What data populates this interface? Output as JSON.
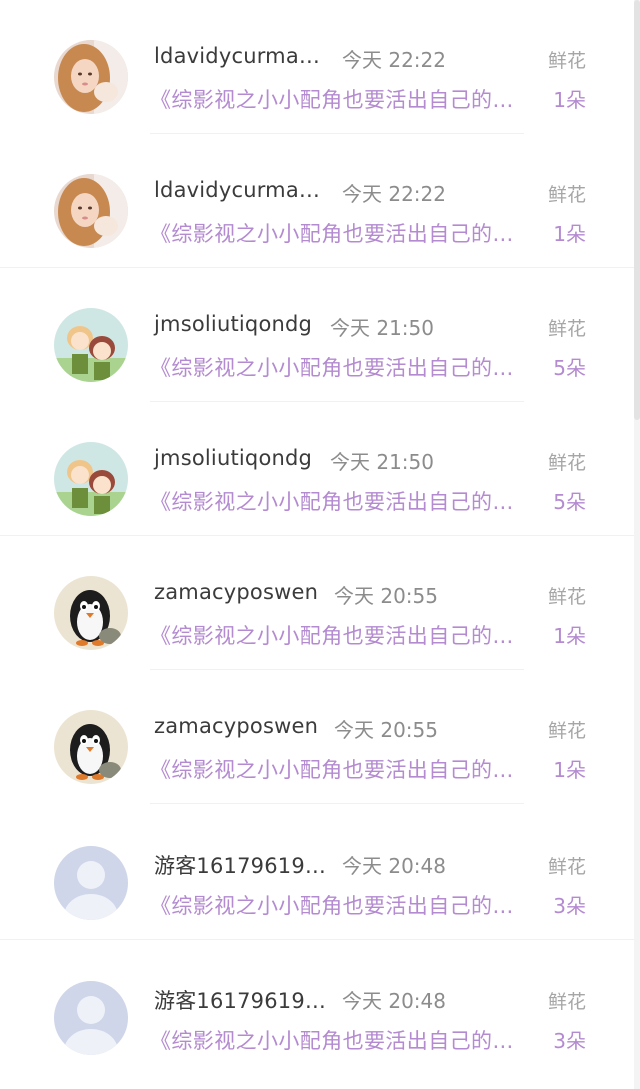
{
  "records": [
    {
      "username": "ldavidycurma…",
      "time": "今天 22:22",
      "book": "《综影视之小小配角也要活出自己的…",
      "gift_label": "鲜花",
      "gift_count": "1朵",
      "avatar": "avatar-photo-woman"
    },
    {
      "username": "ldavidycurma…",
      "time": "今天 22:22",
      "book": "《综影视之小小配角也要活出自己的…",
      "gift_label": "鲜花",
      "gift_count": "1朵",
      "avatar": "avatar-photo-woman"
    },
    {
      "username": "jmsoliutiqondg",
      "time": "今天 21:50",
      "book": "《综影视之小小配角也要活出自己的…",
      "gift_label": "鲜花",
      "gift_count": "5朵",
      "avatar": "avatar-anime-boys"
    },
    {
      "username": "jmsoliutiqondg",
      "time": "今天 21:50",
      "book": "《综影视之小小配角也要活出自己的…",
      "gift_label": "鲜花",
      "gift_count": "5朵",
      "avatar": "avatar-anime-boys"
    },
    {
      "username": "zamacyposwen",
      "time": "今天 20:55",
      "book": "《综影视之小小配角也要活出自己的…",
      "gift_label": "鲜花",
      "gift_count": "1朵",
      "avatar": "avatar-penguin"
    },
    {
      "username": "zamacyposwen",
      "time": "今天 20:55",
      "book": "《综影视之小小配角也要活出自己的…",
      "gift_label": "鲜花",
      "gift_count": "1朵",
      "avatar": "avatar-penguin"
    },
    {
      "username": "游客16179619…",
      "time": "今天 20:48",
      "book": "《综影视之小小配角也要活出自己的…",
      "gift_label": "鲜花",
      "gift_count": "3朵",
      "avatar": "avatar-default-user"
    },
    {
      "username": "游客16179619…",
      "time": "今天 20:48",
      "book": "《综影视之小小配角也要活出自己的…",
      "gift_label": "鲜花",
      "gift_count": "3朵",
      "avatar": "avatar-default-user"
    }
  ],
  "colors": {
    "book_text": "#b48ad0",
    "username_text": "#3b3b3b",
    "time_text": "#8c8c8c",
    "gift_label_text": "#a6a6a6"
  }
}
